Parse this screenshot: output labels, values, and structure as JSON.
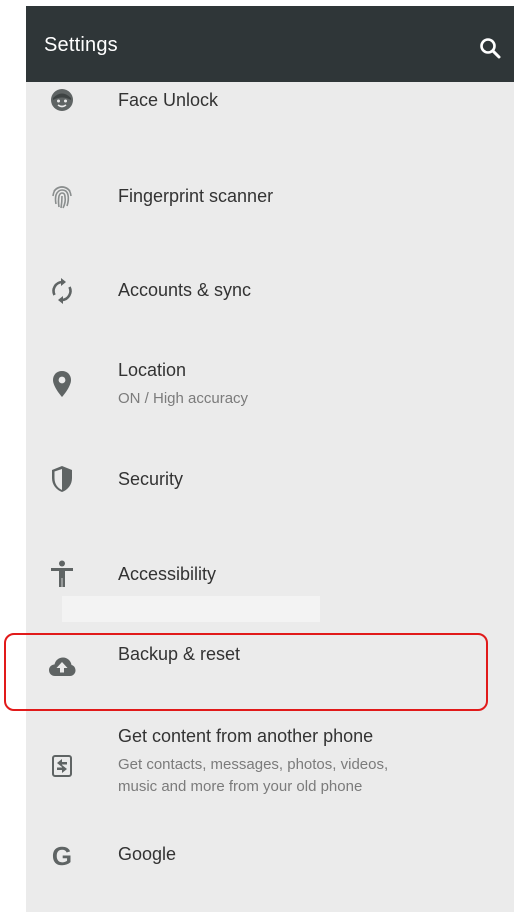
{
  "app_bar": {
    "title": "Settings",
    "search_icon": "search-icon",
    "background": "#2f3638"
  },
  "settings_items": [
    {
      "key": "face_unlock",
      "title": "Face Unlock",
      "icon": "face-icon"
    },
    {
      "key": "fingerprint",
      "title": "Fingerprint scanner",
      "icon": "fingerprint-icon"
    },
    {
      "key": "accounts",
      "title": "Accounts & sync",
      "icon": "sync-icon"
    },
    {
      "key": "location",
      "title": "Location",
      "subtitle": "ON / High accuracy",
      "icon": "location-pin-icon"
    },
    {
      "key": "security",
      "title": "Security",
      "icon": "shield-icon"
    },
    {
      "key": "accessibility",
      "title": "Accessibility",
      "icon": "accessibility-icon"
    },
    {
      "key": "backup",
      "title": "Backup & reset",
      "icon": "cloud-upload-icon"
    },
    {
      "key": "get_content",
      "title": "Get content from another phone",
      "subtitle": "Get contacts, messages, photos, videos,\nmusic and more from your old phone",
      "icon": "phone-transfer-icon"
    },
    {
      "key": "google",
      "title": "Google",
      "icon": "google-g-icon",
      "icon_glyph": "G"
    }
  ],
  "colors": {
    "list_background": "#ebebeb",
    "icon_color": "#5f6464",
    "highlight_outline": "#e11a1a"
  }
}
